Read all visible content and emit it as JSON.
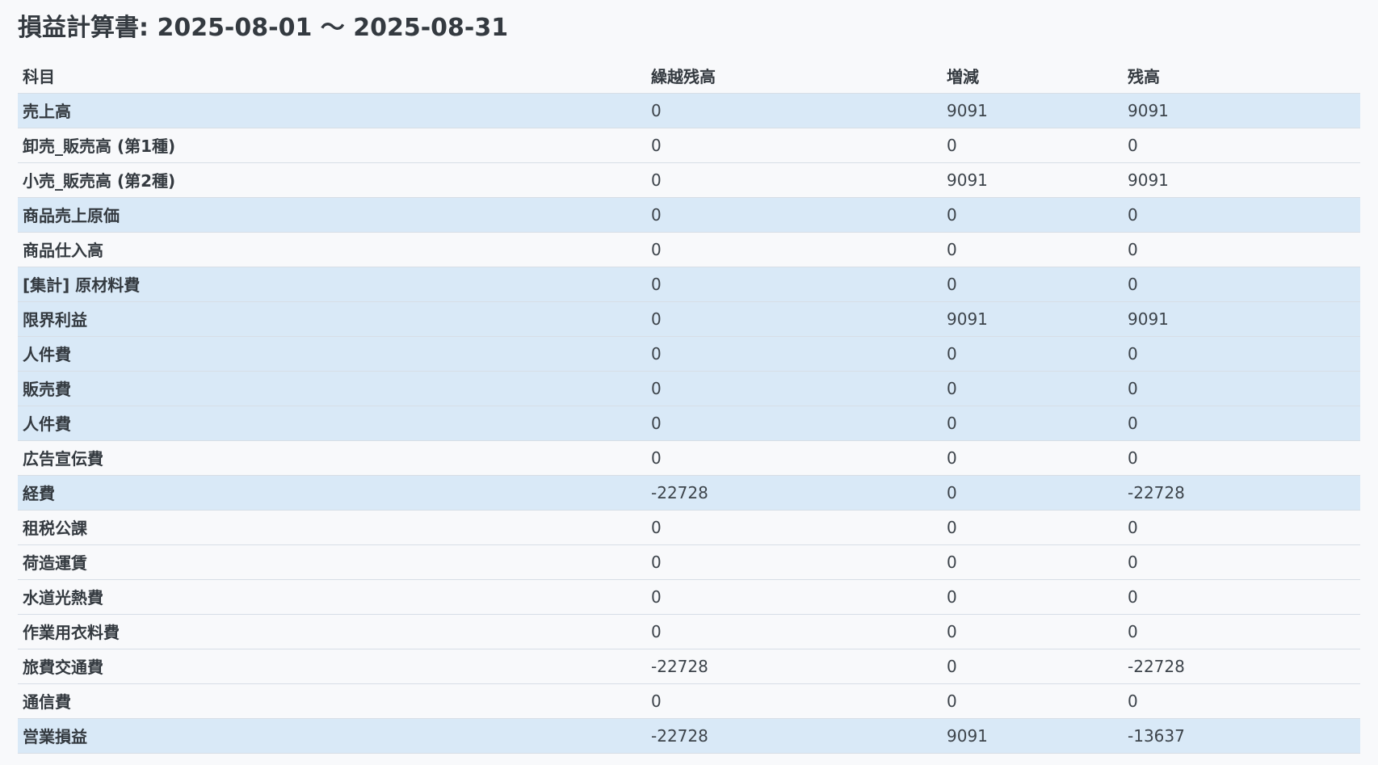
{
  "report": {
    "title": "損益計算書: 2025-08-01 〜 2025-08-31"
  },
  "table": {
    "headers": {
      "account": "科目",
      "carried": "繰越残高",
      "change": "増減",
      "balance": "残高"
    },
    "rows": [
      {
        "account": "売上高",
        "carried": "0",
        "change": "9091",
        "balance": "9091",
        "highlight": true
      },
      {
        "account": "卸売_販売高 (第1種)",
        "carried": "0",
        "change": "0",
        "balance": "0",
        "highlight": false
      },
      {
        "account": "小売_販売高 (第2種)",
        "carried": "0",
        "change": "9091",
        "balance": "9091",
        "highlight": false
      },
      {
        "account": "商品売上原価",
        "carried": "0",
        "change": "0",
        "balance": "0",
        "highlight": true
      },
      {
        "account": "商品仕入高",
        "carried": "0",
        "change": "0",
        "balance": "0",
        "highlight": false
      },
      {
        "account": "[集計] 原材料費",
        "carried": "0",
        "change": "0",
        "balance": "0",
        "highlight": true
      },
      {
        "account": "限界利益",
        "carried": "0",
        "change": "9091",
        "balance": "9091",
        "highlight": true
      },
      {
        "account": "人件費",
        "carried": "0",
        "change": "0",
        "balance": "0",
        "highlight": true
      },
      {
        "account": "販売費",
        "carried": "0",
        "change": "0",
        "balance": "0",
        "highlight": true
      },
      {
        "account": "人件費",
        "carried": "0",
        "change": "0",
        "balance": "0",
        "highlight": true
      },
      {
        "account": "広告宣伝費",
        "carried": "0",
        "change": "0",
        "balance": "0",
        "highlight": false
      },
      {
        "account": "経費",
        "carried": "-22728",
        "change": "0",
        "balance": "-22728",
        "highlight": true
      },
      {
        "account": "租税公課",
        "carried": "0",
        "change": "0",
        "balance": "0",
        "highlight": false
      },
      {
        "account": "荷造運賃",
        "carried": "0",
        "change": "0",
        "balance": "0",
        "highlight": false
      },
      {
        "account": "水道光熱費",
        "carried": "0",
        "change": "0",
        "balance": "0",
        "highlight": false
      },
      {
        "account": "作業用衣料費",
        "carried": "0",
        "change": "0",
        "balance": "0",
        "highlight": false
      },
      {
        "account": "旅費交通費",
        "carried": "-22728",
        "change": "0",
        "balance": "-22728",
        "highlight": false
      },
      {
        "account": "通信費",
        "carried": "0",
        "change": "0",
        "balance": "0",
        "highlight": false
      },
      {
        "account": "営業損益",
        "carried": "-22728",
        "change": "9091",
        "balance": "-13637",
        "highlight": true
      }
    ]
  },
  "colors": {
    "background": "#f8f9fb",
    "highlight_row": "#d9e9f7",
    "text": "#343a40",
    "border": "#d7dee6"
  }
}
